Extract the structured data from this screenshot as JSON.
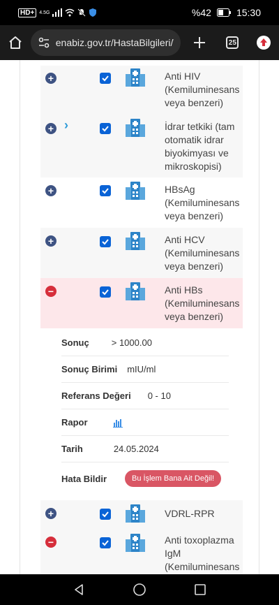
{
  "status_bar": {
    "network_left": "HD+",
    "network_small": "4.5G",
    "battery": "%42",
    "time": "15:30"
  },
  "browser": {
    "url": "enabiz.gov.tr/HastaBilgileri/Tal",
    "tab_count": "25",
    "icons": {
      "home": "home-icon",
      "tune": "tune-icon",
      "plus": "plus-icon",
      "tabs": "tabs-icon",
      "menu": "profile-menu-icon"
    }
  },
  "tests": [
    {
      "name": "Anti HIV (Kemiluminesans veya benzeri)",
      "expand": "+",
      "chevron": false,
      "state": "collapsed"
    },
    {
      "name": "İdrar tetkiki (tam otomatik idrar biyokimyası ve mikroskopisi)",
      "expand": "+",
      "chevron": true,
      "state": "collapsed"
    },
    {
      "name": "HBsAg (Kemiluminesans veya benzeri)",
      "expand": "+",
      "chevron": false,
      "state": "collapsed"
    },
    {
      "name": "Anti HCV (Kemiluminesans veya benzeri)",
      "expand": "+",
      "chevron": false,
      "state": "collapsed"
    },
    {
      "name": "Anti HBs (Kemiluminesans veya benzeri)",
      "expand": "−",
      "chevron": false,
      "state": "expanded"
    },
    {
      "name": "VDRL-RPR",
      "expand": "+",
      "chevron": false,
      "state": "collapsed"
    },
    {
      "name": "Anti toxoplazma IgM (Kemiluminesans",
      "expand": "−",
      "chevron": false,
      "state": "expanded"
    }
  ],
  "details": {
    "sonuc_label": "Sonuç",
    "sonuc_value": "> 1000.00",
    "birim_label": "Sonuç Birimi",
    "birim_value": "mIU/ml",
    "referans_label": "Referans Değeri",
    "referans_value": "0 - 10",
    "rapor_label": "Rapor",
    "tarih_label": "Tarih",
    "tarih_value": "24.05.2024",
    "hata_label": "Hata Bildir",
    "hata_button": "Bu İşlem Bana Ait Değil!"
  },
  "colors": {
    "accent_blue": "#0a63d6",
    "expand_plus": "#3e5383",
    "expand_minus": "#d62e3b",
    "error_button": "#d95664",
    "pink_row": "#fde7ea"
  }
}
